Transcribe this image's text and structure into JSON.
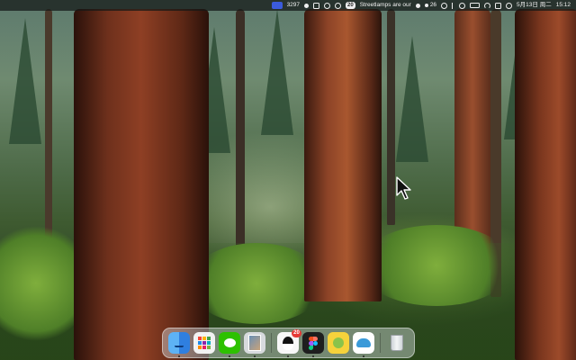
{
  "menubar": {
    "counter": "3297",
    "notification": "Streetlamps are our",
    "badge_count": "20",
    "temperature": "26",
    "date": "5月13日",
    "weekday": "周二",
    "time": "15:12"
  },
  "dock": {
    "apps": [
      {
        "name": "Finder",
        "running": true
      },
      {
        "name": "Launchpad",
        "running": false
      },
      {
        "name": "WeChat",
        "running": true
      },
      {
        "name": "Preview",
        "running": true
      },
      {
        "name": "QQ",
        "running": true,
        "badge": "20"
      },
      {
        "name": "Figma",
        "running": true
      },
      {
        "name": "Notes App",
        "running": false
      },
      {
        "name": "Cloud App",
        "running": true
      },
      {
        "name": "Trash",
        "running": false
      }
    ]
  },
  "colors": {
    "menubar_bg": "#14181690",
    "dock_bg": "#e1e8eb6b",
    "accent": "#3b5bdb",
    "badge": "#e53935"
  }
}
